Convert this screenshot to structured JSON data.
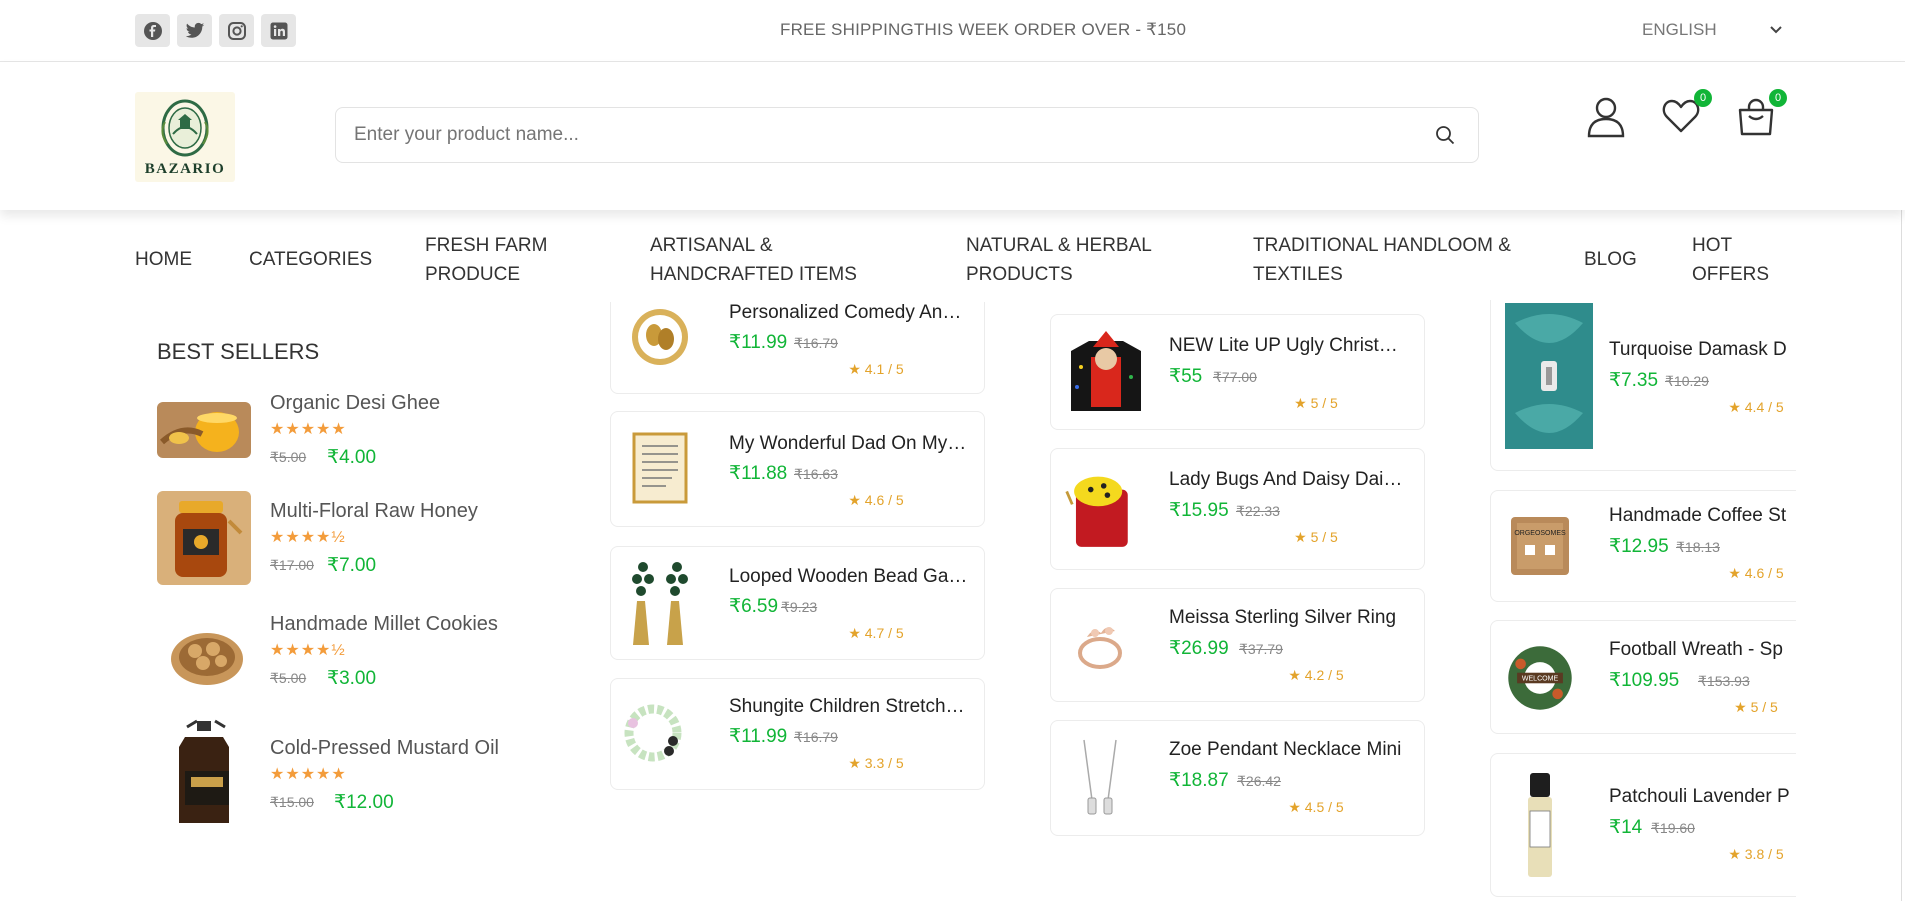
{
  "topbar": {
    "social": [
      "facebook-icon",
      "twitter-icon",
      "instagram-icon",
      "linkedin-icon"
    ],
    "promo": "FREE SHIPPINGTHIS WEEK ORDER OVER - ₹150",
    "language": "ENGLISH"
  },
  "header": {
    "logo_text": "BAZARIO",
    "search_placeholder": "Enter your product name...",
    "wishlist_count": "0",
    "cart_count": "0"
  },
  "nav": {
    "items": [
      {
        "line1": "HOME",
        "line2": ""
      },
      {
        "line1": "CATEGORIES",
        "line2": ""
      },
      {
        "line1": "FRESH FARM",
        "line2": "PRODUCE"
      },
      {
        "line1": "ARTISANAL &",
        "line2": "HANDCRAFTED ITEMS"
      },
      {
        "line1": "NATURAL & HERBAL",
        "line2": "PRODUCTS"
      },
      {
        "line1": "TRADITIONAL HANDLOOM &",
        "line2": "TEXTILES"
      },
      {
        "line1": "BLOG",
        "line2": ""
      },
      {
        "line1": "HOT",
        "line2": "OFFERS"
      }
    ]
  },
  "best_sellers": {
    "title": "BEST SELLERS",
    "items": [
      {
        "name": "Organic Desi Ghee",
        "stars": "★★★★★",
        "old": "₹5.00",
        "price": "₹4.00"
      },
      {
        "name": "Multi-Floral Raw Honey",
        "stars": "★★★★½",
        "old": "₹17.00",
        "price": "₹7.00"
      },
      {
        "name": "Handmade Millet Cookies",
        "stars": "★★★★½",
        "old": "₹5.00",
        "price": "₹3.00"
      },
      {
        "name": "Cold-Pressed Mustard Oil",
        "stars": "★★★★★",
        "old": "₹15.00",
        "price": "₹12.00"
      }
    ]
  },
  "products": {
    "col1": [
      {
        "name": "Personalized Comedy And Tragedy Mask",
        "price": "₹11.99",
        "old": "₹16.79",
        "rating": "4.1 / 5"
      },
      {
        "name": "My Wonderful Dad On My Wedding Day",
        "price": "₹11.88",
        "old": "₹16.63",
        "rating": "4.6 / 5"
      },
      {
        "name": "Looped Wooden Bead Garland",
        "price": "₹6.59",
        "old": "₹9.23",
        "rating": "4.7 / 5"
      },
      {
        "name": "Shungite Children Stretch Bracelet",
        "price": "₹11.99",
        "old": "₹16.79",
        "rating": "3.3 / 5"
      }
    ],
    "col2": [
      {
        "name": "NEW Lite UP Ugly Christmas Sweater",
        "price": "₹55",
        "old": "₹77.00",
        "rating": "5 / 5"
      },
      {
        "name": "Lady Bugs And Daisy Daisies Pouch",
        "price": "₹15.95",
        "old": "₹22.33",
        "rating": "5 / 5"
      },
      {
        "name": "Meissa Sterling Silver Ring",
        "price": "₹26.99",
        "old": "₹37.79",
        "rating": "4.2 / 5"
      },
      {
        "name": "Zoe Pendant Necklace Mini",
        "price": "₹18.87",
        "old": "₹26.42",
        "rating": "4.5 / 5"
      }
    ],
    "col3": [
      {
        "name": "Turquoise Damask D",
        "price": "₹7.35",
        "old": "₹10.29",
        "rating": "4.4 / 5"
      },
      {
        "name": "Handmade Coffee St",
        "price": "₹12.95",
        "old": "₹18.13",
        "rating": "4.6 / 5"
      },
      {
        "name": "Football Wreath - Sp",
        "price": "₹109.95",
        "old": "₹153.93",
        "rating": "5 / 5"
      },
      {
        "name": "Patchouli Lavender P",
        "price": "₹14",
        "old": "₹19.60",
        "rating": "3.8 / 5"
      }
    ]
  }
}
